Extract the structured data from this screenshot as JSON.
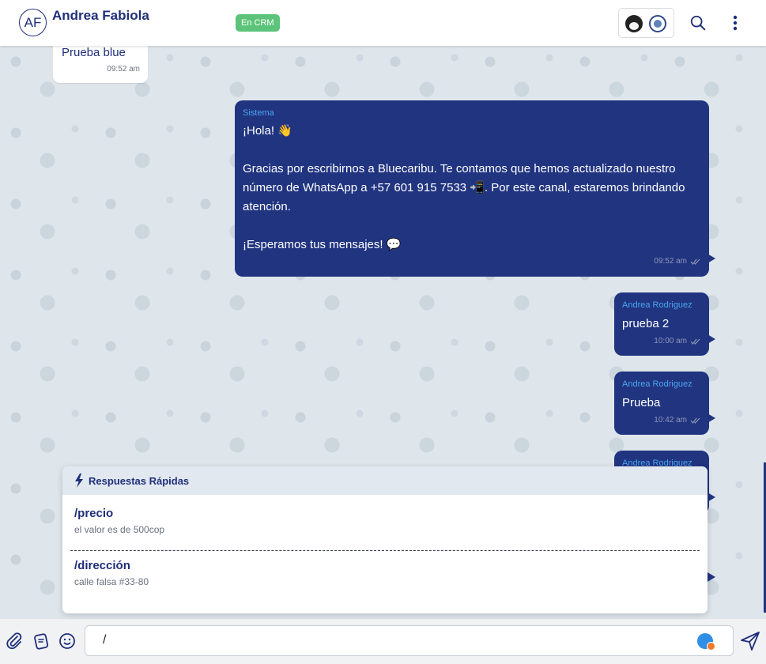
{
  "header": {
    "avatar_initials": "AF",
    "contact_name": "Andrea Fabiola",
    "crm_badge": "En CRM"
  },
  "messages": [
    {
      "direction": "in",
      "text": "Prueba blue",
      "time": "09:52 am"
    },
    {
      "direction": "out",
      "sender": "Sistema",
      "text": "¡Hola! 👋\n\nGracias por escribirnos a Bluecaribu. Te contamos que hemos actualizado nuestro número de WhatsApp a +57 601 915 7533 📲. Por este canal, estaremos brindando atención.\n\n¡Esperamos tus mensajes! 💬",
      "time": "09:52 am"
    },
    {
      "direction": "out",
      "sender": "Andrea Rodriguez",
      "text": "prueba 2",
      "time": "10:00 am"
    },
    {
      "direction": "out",
      "sender": "Andrea Rodriguez",
      "text": "Prueba",
      "time": "10:42 am"
    },
    {
      "direction": "out",
      "sender": "Andrea Rodriguez",
      "text": "",
      "time": ""
    }
  ],
  "quick_replies": {
    "title": "Respuestas Rápidas",
    "items": [
      {
        "command": "/precio",
        "text": "el valor es de 500cop"
      },
      {
        "command": "/dirección",
        "text": "calle falsa #33-80"
      }
    ]
  },
  "composer": {
    "value": "/"
  },
  "icons": {
    "attach": "paperclip-icon",
    "templates": "template-icon",
    "emoji": "emoji-icon",
    "send": "send-icon",
    "search": "search-icon",
    "menu": "kebab-menu-icon",
    "quick_reply": "lightning-icon"
  },
  "colors": {
    "brand": "#213480",
    "crm_badge": "#5cc47a",
    "sender_label": "#4aa6f0"
  }
}
